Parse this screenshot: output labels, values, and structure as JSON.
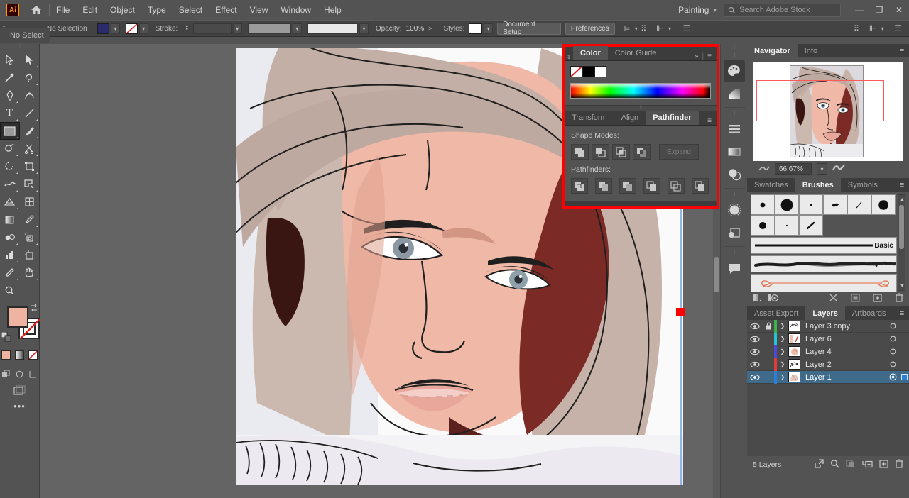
{
  "app": {
    "logo": "Ai",
    "home_icon": "home-icon"
  },
  "menubar": {
    "items": [
      "File",
      "Edit",
      "Object",
      "Type",
      "Select",
      "Effect",
      "View",
      "Window",
      "Help"
    ],
    "workspace": "Painting",
    "workspace_caret": "▾",
    "search_placeholder": "Search Adobe Stock",
    "window_buttons": [
      "—",
      "❐",
      "✕"
    ]
  },
  "controlbar": {
    "selection_status": "No Selection",
    "fill_label": "",
    "fill_color": "#2b2b6b",
    "stroke_label": "Stroke:",
    "stroke_weight": "",
    "opacity_label": "Opacity:",
    "opacity_value": "100%",
    "styles_label": "Styles:",
    "document_setup": "Document Setup",
    "preferences": "Preferences",
    "caret": "▾"
  },
  "left_tab": {
    "label": "No Select"
  },
  "toolbar": {
    "tools": [
      {
        "name": "selection-tool",
        "glyph": "▷",
        "selected": false
      },
      {
        "name": "direct-selection-tool",
        "glyph": "▶",
        "selected": false
      },
      {
        "name": "magic-wand-tool",
        "glyph": "✨",
        "selected": false
      },
      {
        "name": "lasso-tool",
        "glyph": "➰",
        "selected": false
      },
      {
        "name": "pen-tool",
        "glyph": "✒",
        "selected": false
      },
      {
        "name": "curvature-tool",
        "glyph": "∿",
        "selected": false
      },
      {
        "name": "type-tool",
        "glyph": "T",
        "selected": false
      },
      {
        "name": "line-segment-tool",
        "glyph": "╱",
        "selected": false
      },
      {
        "name": "rectangle-tool",
        "glyph": "▣",
        "selected": true
      },
      {
        "name": "paintbrush-tool",
        "glyph": "✎",
        "selected": false
      },
      {
        "name": "shaper-tool",
        "glyph": "◌",
        "selected": false
      },
      {
        "name": "scissors-tool",
        "glyph": "✂",
        "selected": false
      },
      {
        "name": "rotate-tool",
        "glyph": "↺",
        "selected": false
      },
      {
        "name": "free-transform-tool",
        "glyph": "❐",
        "selected": false
      },
      {
        "name": "width-tool",
        "glyph": "∿",
        "selected": false
      },
      {
        "name": "shape-builder-tool",
        "glyph": "◩",
        "selected": false
      },
      {
        "name": "perspective-grid-tool",
        "glyph": "◱",
        "selected": false
      },
      {
        "name": "mesh-tool",
        "glyph": "▦",
        "selected": false
      },
      {
        "name": "gradient-tool",
        "glyph": "▧",
        "selected": false
      },
      {
        "name": "eyedropper-tool",
        "glyph": "⚗",
        "selected": false
      },
      {
        "name": "blend-tool",
        "glyph": "◐",
        "selected": false
      },
      {
        "name": "symbol-sprayer-tool",
        "glyph": "☂",
        "selected": false
      },
      {
        "name": "column-graph-tool",
        "glyph": "▉",
        "selected": false
      },
      {
        "name": "artboard-tool",
        "glyph": "⬚",
        "selected": false
      },
      {
        "name": "slice-tool",
        "glyph": "✒",
        "selected": false
      },
      {
        "name": "hand-tool",
        "glyph": "✋",
        "selected": false
      },
      {
        "name": "zoom-tool",
        "glyph": "⚲",
        "selected": false
      }
    ],
    "fill_color": "#efb3a1",
    "stroke_color": "#ffffff",
    "more_tools": "•••"
  },
  "color_panel": {
    "tabs": [
      {
        "label": "Color",
        "active": true
      },
      {
        "label": "Color Guide",
        "active": false
      }
    ],
    "collapse": "»",
    "menu": "≡",
    "swatches": [
      {
        "name": "none-swatch",
        "color": "#ffffff"
      },
      {
        "name": "black-swatch",
        "color": "#000000"
      },
      {
        "name": "white-swatch",
        "color": "#ffffff"
      }
    ]
  },
  "pathfinder_panel": {
    "tabs": [
      {
        "label": "Transform",
        "active": false
      },
      {
        "label": "Align",
        "active": false
      },
      {
        "label": "Pathfinder",
        "active": true
      }
    ],
    "menu": "≡",
    "shape_modes_label": "Shape Modes:",
    "shape_modes": [
      "unite",
      "minus-front",
      "intersect",
      "exclude"
    ],
    "expand_label": "Expand",
    "pathfinders_label": "Pathfinders:",
    "pathfinders": [
      "divide",
      "trim",
      "merge",
      "crop",
      "outline",
      "minus-back"
    ]
  },
  "icon_dock": {
    "icons": [
      {
        "name": "color-palette-icon",
        "active": true
      },
      {
        "name": "gradient-icon",
        "active": false
      },
      {
        "name": "stroke-icon",
        "active": false
      },
      {
        "name": "gradient-panel-icon",
        "active": false
      },
      {
        "name": "transparency-icon",
        "active": false
      },
      {
        "name": "brushes-icon",
        "active": false
      },
      {
        "name": "pathfinder-icon",
        "active": false
      },
      {
        "name": "comments-icon",
        "active": false
      }
    ]
  },
  "navigator_panel": {
    "tabs": [
      {
        "label": "Navigator",
        "active": true
      },
      {
        "label": "Info",
        "active": false
      }
    ],
    "menu": "≡",
    "zoom_value": "66,67%",
    "zoom_out_icon": "zoom-out-icon",
    "zoom_in_icon": "zoom-in-icon",
    "caret": "▾"
  },
  "brushes_panel": {
    "tabs": [
      {
        "label": "Swatches",
        "active": false
      },
      {
        "label": "Brushes",
        "active": true
      },
      {
        "label": "Symbols",
        "active": false
      }
    ],
    "menu": "≡",
    "brush_label": "Basic",
    "footer_icons": [
      "brush-libraries-icon",
      "libraries-icon",
      "remove-brush-stroke-icon",
      "options-icon",
      "new-brush-icon",
      "delete-brush-icon"
    ]
  },
  "layers_panel": {
    "tabs": [
      {
        "label": "Asset Export",
        "active": false
      },
      {
        "label": "Layers",
        "active": true
      },
      {
        "label": "Artboards",
        "active": false
      }
    ],
    "menu": "≡",
    "layers": [
      {
        "name": "Layer 3 copy",
        "color": "#3bb54a",
        "visible": true,
        "locked": true,
        "selected": false
      },
      {
        "name": "Layer 6",
        "color": "#25c3d4",
        "visible": true,
        "locked": false,
        "selected": false
      },
      {
        "name": "Layer 4",
        "color": "#4b49d6",
        "visible": true,
        "locked": false,
        "selected": false
      },
      {
        "name": "Layer 2",
        "color": "#e03a3a",
        "visible": true,
        "locked": false,
        "selected": false
      },
      {
        "name": "Layer 1",
        "color": "#2d7ed6",
        "visible": true,
        "locked": false,
        "selected": true
      }
    ],
    "count_label": "5 Layers",
    "footer_icons": [
      "locate-object-icon",
      "find-icon",
      "make-clipping-mask-icon",
      "create-new-sublayer-icon",
      "create-new-layer-icon",
      "delete-selection-icon"
    ]
  },
  "artwork": {
    "description": "portrait-illustration",
    "skin_color": "#f0b9a7",
    "hair_color": "#bda99f",
    "dark_red_color": "#6d2420",
    "line_color": "#1a1a1a"
  },
  "annotation": {
    "highlight_color": "#ff0000"
  }
}
